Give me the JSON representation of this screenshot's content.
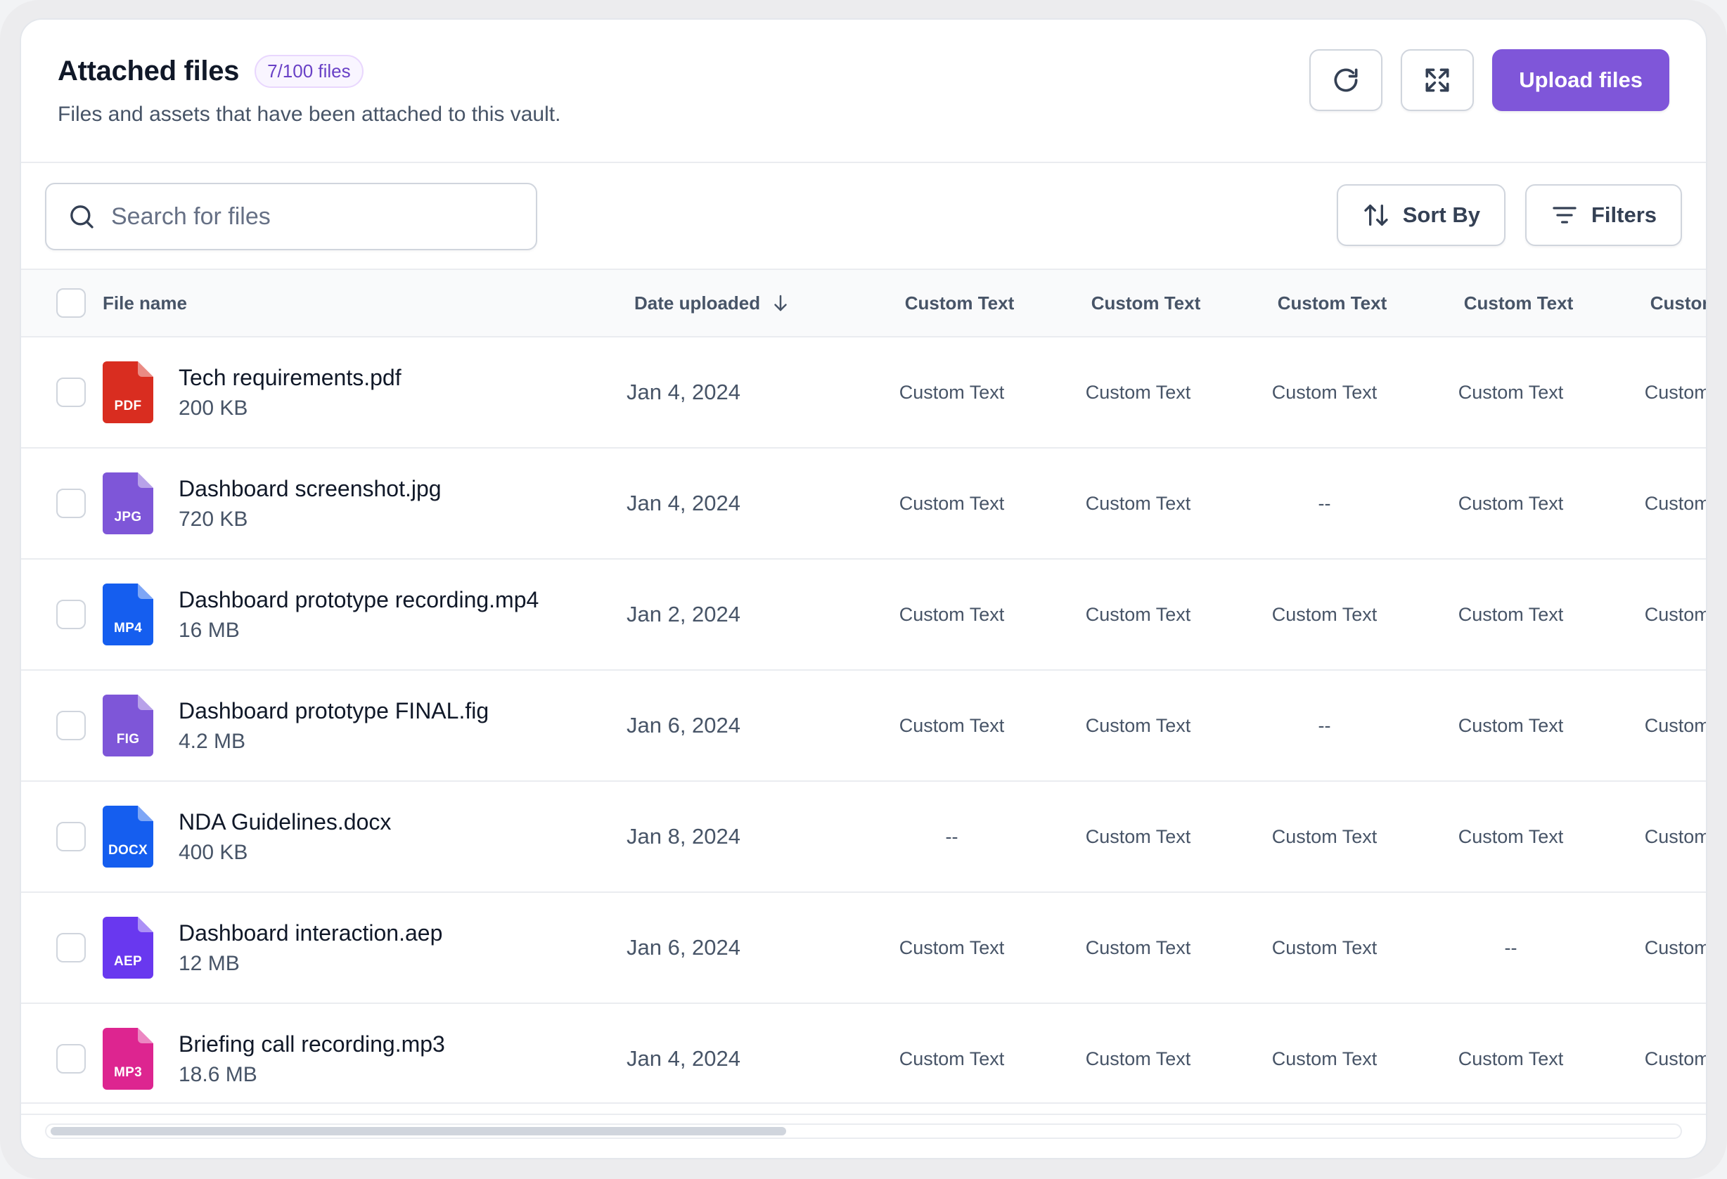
{
  "header": {
    "title": "Attached files",
    "count_badge": "7/100 files",
    "subtitle": "Files and assets that have been attached to this vault.",
    "refresh_icon": "refresh-icon",
    "expand_icon": "expand-icon",
    "upload_label": "Upload files"
  },
  "toolbar": {
    "search_placeholder": "Search for files",
    "search_value": "",
    "sort_label": "Sort By",
    "filters_label": "Filters"
  },
  "table": {
    "columns": [
      "File name",
      "Date uploaded",
      "Custom Text",
      "Custom Text",
      "Custom Text",
      "Custom Text",
      "Custom Text"
    ],
    "rows": [
      {
        "name": "Tech requirements.pdf",
        "size": "200 KB",
        "ext": "PDF",
        "color": "#d92d20",
        "date": "Jan 4, 2024",
        "custom": [
          "Custom Text",
          "Custom Text",
          "Custom Text",
          "Custom Text",
          "Custom Text"
        ]
      },
      {
        "name": "Dashboard screenshot.jpg",
        "size": "720 KB",
        "ext": "JPG",
        "color": "#7e56d8",
        "date": "Jan 4, 2024",
        "custom": [
          "Custom Text",
          "Custom Text",
          "--",
          "Custom Text",
          "Custom Text"
        ]
      },
      {
        "name": "Dashboard prototype recording.mp4",
        "size": "16 MB",
        "ext": "MP4",
        "color": "#155eef",
        "date": "Jan 2, 2024",
        "custom": [
          "Custom Text",
          "Custom Text",
          "Custom Text",
          "Custom Text",
          "Custom Text"
        ]
      },
      {
        "name": "Dashboard prototype FINAL.fig",
        "size": "4.2 MB",
        "ext": "FIG",
        "color": "#7e56d8",
        "date": "Jan 6, 2024",
        "custom": [
          "Custom Text",
          "Custom Text",
          "--",
          "Custom Text",
          "Custom Text"
        ]
      },
      {
        "name": "NDA Guidelines.docx",
        "size": "400 KB",
        "ext": "DOCX",
        "color": "#155eef",
        "date": "Jan 8, 2024",
        "custom": [
          "--",
          "Custom Text",
          "Custom Text",
          "Custom Text",
          "Custom Text"
        ]
      },
      {
        "name": "Dashboard interaction.aep",
        "size": "12 MB",
        "ext": "AEP",
        "color": "#6938ef",
        "date": "Jan 6, 2024",
        "custom": [
          "Custom Text",
          "Custom Text",
          "Custom Text",
          "--",
          "Custom Text"
        ]
      },
      {
        "name": "Briefing call recording.mp3",
        "size": "18.6 MB",
        "ext": "MP3",
        "color": "#dd2590",
        "date": "Jan 4, 2024",
        "custom": [
          "Custom Text",
          "Custom Text",
          "Custom Text",
          "Custom Text",
          "Custom Text"
        ]
      }
    ]
  },
  "colors": {
    "accent": "#7f56d9",
    "border": "#d0d5dd",
    "text_primary": "#101828",
    "text_secondary": "#475467"
  }
}
